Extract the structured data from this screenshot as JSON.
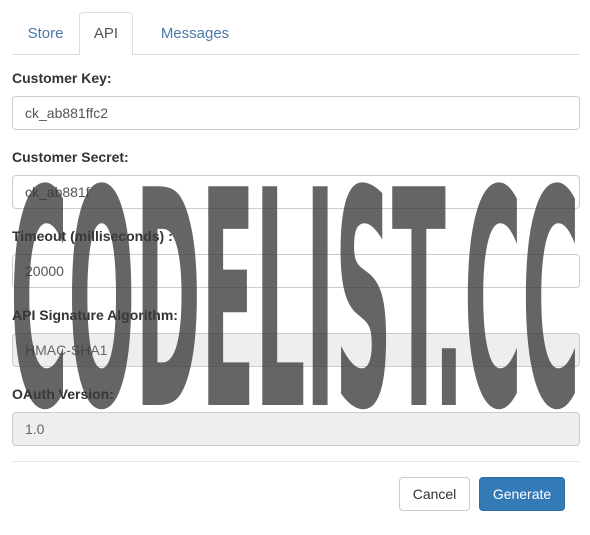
{
  "tabs": {
    "store": "Store",
    "api": "API",
    "messages": "Messages"
  },
  "fields": {
    "customer_key": {
      "label": "Customer Key:",
      "value": "ck_ab881ffc2"
    },
    "customer_secret": {
      "label": "Customer Secret:",
      "value": "ck_ab881f"
    },
    "timeout": {
      "label": "Timeout (milliseconds) :",
      "value": "20000"
    },
    "signature": {
      "label": "API Signature Algorithm:",
      "value": "HMAC-SHA1"
    },
    "oauth": {
      "label": "OAuth Version:",
      "value": "1.0"
    }
  },
  "buttons": {
    "cancel": "Cancel",
    "generate": "Generate"
  },
  "watermark": {
    "text": "CODELIST.CC",
    "color": "#3a3a3a"
  },
  "colors": {
    "accent": "#337ab7",
    "tab_link": "#4a78a8"
  }
}
